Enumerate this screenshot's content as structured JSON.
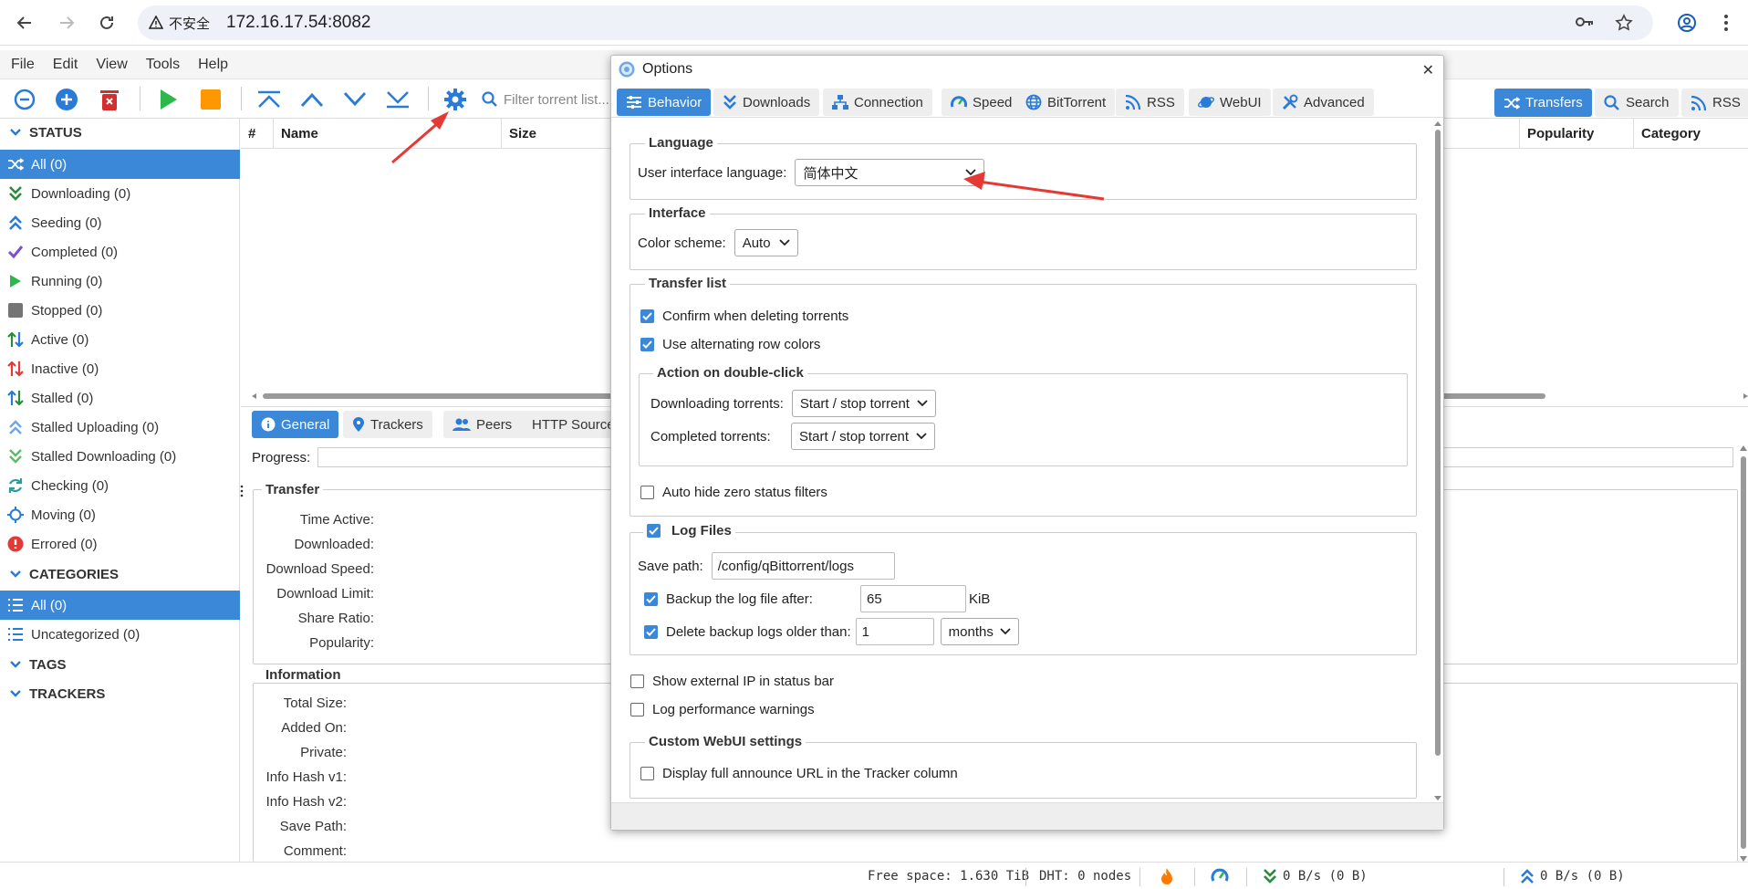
{
  "browser": {
    "security_label": "不安全",
    "url": "172.16.17.54:8082"
  },
  "menu": [
    "File",
    "Edit",
    "View",
    "Tools",
    "Help"
  ],
  "toolbar": {
    "filter_placeholder": "Filter torrent list...",
    "tabs": [
      "Transfers",
      "Search",
      "RSS"
    ]
  },
  "sidebar": {
    "status_header": "STATUS",
    "status_items": [
      {
        "label": "All (0)",
        "icon": "shuffle-icon"
      },
      {
        "label": "Downloading (0)",
        "icon": "double-chevron-down-icon"
      },
      {
        "label": "Seeding (0)",
        "icon": "double-chevron-up-icon"
      },
      {
        "label": "Completed (0)",
        "icon": "check-icon"
      },
      {
        "label": "Running (0)",
        "icon": "play-icon"
      },
      {
        "label": "Stopped (0)",
        "icon": "stop-icon"
      },
      {
        "label": "Active (0)",
        "icon": "active-arrows-icon"
      },
      {
        "label": "Inactive (0)",
        "icon": "inactive-arrows-icon"
      },
      {
        "label": "Stalled (0)",
        "icon": "stalled-arrows-icon"
      },
      {
        "label": "Stalled Uploading (0)",
        "icon": "stalled-up-icon"
      },
      {
        "label": "Stalled Downloading (0)",
        "icon": "stalled-down-icon"
      },
      {
        "label": "Checking (0)",
        "icon": "refresh-icon"
      },
      {
        "label": "Moving (0)",
        "icon": "crosshair-icon"
      },
      {
        "label": "Errored (0)",
        "icon": "error-icon"
      }
    ],
    "categories_header": "CATEGORIES",
    "category_items": [
      "All (0)",
      "Uncategorized (0)"
    ],
    "tags_header": "TAGS",
    "trackers_header": "TRACKERS"
  },
  "table": {
    "columns": [
      "#",
      "Name",
      "Size",
      "Popularity",
      "Category"
    ]
  },
  "details": {
    "tabs": [
      "General",
      "Trackers",
      "Peers",
      "HTTP Sources"
    ],
    "progress_label": "Progress:",
    "transfer_legend": "Transfer",
    "transfer_fields": [
      "Time Active:",
      "Downloaded:",
      "Download Speed:",
      "Download Limit:",
      "Share Ratio:",
      "Popularity:"
    ],
    "info_legend": "Information",
    "info_fields": [
      "Total Size:",
      "Added On:",
      "Private:",
      "Info Hash v1:",
      "Info Hash v2:",
      "Save Path:",
      "Comment:"
    ]
  },
  "statusbar": {
    "free_space": "Free space: 1.630 TiB",
    "dht": "DHT: 0 nodes",
    "download": "0 B/s (0 B)",
    "upload": "0 B/s (0 B)"
  },
  "options": {
    "title": "Options",
    "tabs": [
      "Behavior",
      "Downloads",
      "Connection",
      "Speed",
      "BitTorrent",
      "RSS",
      "WebUI",
      "Advanced"
    ],
    "language_legend": "Language",
    "ui_language_label": "User interface language:",
    "ui_language_value": "简体中文",
    "interface_legend": "Interface",
    "color_scheme_label": "Color scheme:",
    "color_scheme_value": "Auto",
    "transfer_list_legend": "Transfer list",
    "confirm_delete": "Confirm when deleting torrents",
    "alt_row_colors": "Use alternating row colors",
    "double_click_legend": "Action on double-click",
    "downloading_torrents_label": "Downloading torrents:",
    "downloading_torrents_value": "Start / stop torrent",
    "completed_torrents_label": "Completed torrents:",
    "completed_torrents_value": "Start / stop torrent",
    "auto_hide_zero": "Auto hide zero status filters",
    "log_files_legend": "Log Files",
    "save_path_label": "Save path:",
    "save_path_value": "/config/qBittorrent/logs",
    "backup_after_label": "Backup the log file after:",
    "backup_after_value": "65",
    "backup_unit": "KiB",
    "delete_older_label": "Delete backup logs older than:",
    "delete_older_value": "1",
    "delete_older_unit": "months",
    "show_external_ip": "Show external IP in status bar",
    "log_perf_warnings": "Log performance warnings",
    "custom_webui_legend": "Custom WebUI settings",
    "full_announce_url": "Display full announce URL in the Tracker column"
  },
  "colors": {
    "accent": "#3b87d8",
    "annotation_arrow": "#e53935"
  }
}
